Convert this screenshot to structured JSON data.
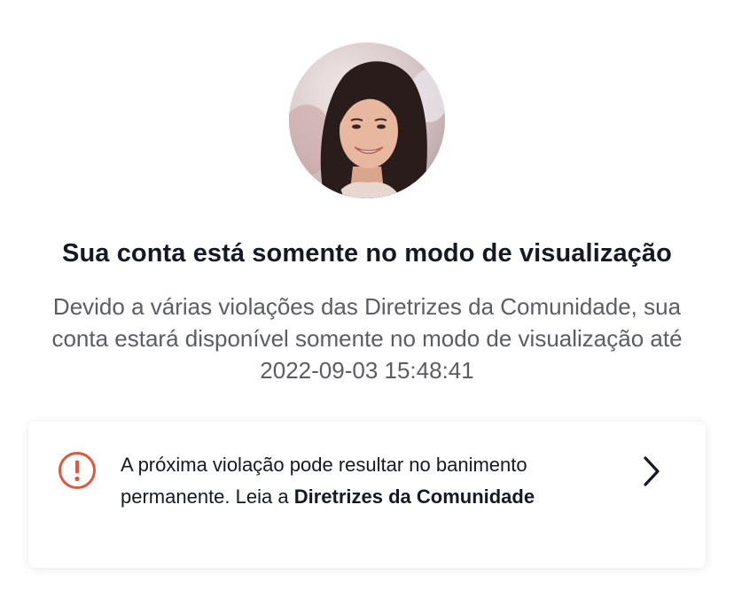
{
  "profile": {
    "avatar_icon": "profile-photo"
  },
  "notice": {
    "title": "Sua conta está somente no modo de visualização",
    "description": "Devido a várias violações das Diretrizes da Comunidade, sua conta estará disponível somente no modo de visualização até 2022-09-03 15:48:41"
  },
  "warning": {
    "icon": "alert-circle-icon",
    "icon_color": "#e0573f",
    "text": "A próxima violação pode resultar no banimento permanente. Leia a ",
    "link_label": "Diretrizes da Comunidade",
    "chevron_icon": "chevron-right-icon"
  }
}
